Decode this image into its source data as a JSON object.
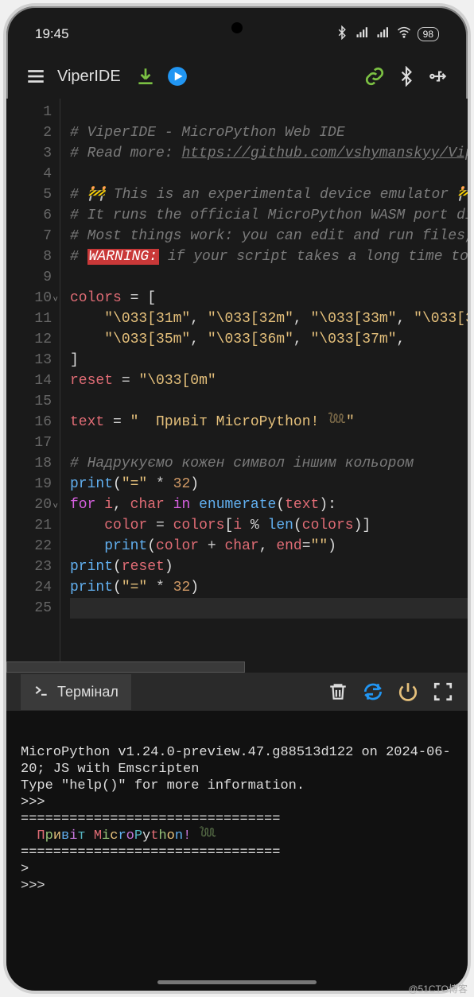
{
  "status": {
    "time": "19:45",
    "battery": "98"
  },
  "app": {
    "title": "ViperIDE"
  },
  "editor": {
    "lines": [
      {
        "n": 1,
        "html": ""
      },
      {
        "n": 2,
        "html": "<span class='c'># ViperIDE - MicroPython Web IDE</span>"
      },
      {
        "n": 3,
        "html": "<span class='c'># Read more: <a>https://github.com/vshymanskyy/Vip</a></span>"
      },
      {
        "n": 4,
        "html": ""
      },
      {
        "n": 5,
        "html": "<span class='c'># 🚧 This is an experimental device emulator 🚧</span>"
      },
      {
        "n": 6,
        "html": "<span class='c'># It runs the official MicroPython WASM port di</span>"
      },
      {
        "n": 7,
        "html": "<span class='c'># Most things work: you can edit and run files,</span>"
      },
      {
        "n": 8,
        "html": "<span class='c'># </span><span class='warn'>WARNING:</span><span class='c'> if your script takes a long time to </span>"
      },
      {
        "n": 9,
        "html": ""
      },
      {
        "n": 10,
        "fold": true,
        "html": "<span class='var'>colors</span> <span class='op'>=</span> ["
      },
      {
        "n": 11,
        "html": "    <span class='str'>\"\\033[31m\"</span>, <span class='str'>\"\\033[32m\"</span>, <span class='str'>\"\\033[33m\"</span>, <span class='str'>\"\\033[3</span>"
      },
      {
        "n": 12,
        "html": "    <span class='str'>\"\\033[35m\"</span>, <span class='str'>\"\\033[36m\"</span>, <span class='str'>\"\\033[37m\"</span>,"
      },
      {
        "n": 13,
        "html": "]"
      },
      {
        "n": 14,
        "html": "<span class='var'>reset</span> <span class='op'>=</span> <span class='str'>\"\\033[0m\"</span>"
      },
      {
        "n": 15,
        "html": ""
      },
      {
        "n": 16,
        "html": "<span class='var'>text</span> <span class='op'>=</span> <span class='str'>\"  Привіт MicroPython! 𓆙\"</span>"
      },
      {
        "n": 17,
        "html": ""
      },
      {
        "n": 18,
        "html": "<span class='c'># Надрукуємо кожен символ іншим кольором</span>"
      },
      {
        "n": 19,
        "html": "<span class='fn'>print</span>(<span class='str'>\"=\"</span> <span class='op'>*</span> <span class='num'>32</span>)"
      },
      {
        "n": 20,
        "fold": true,
        "html": "<span class='kw'>for</span> <span class='var'>i</span>, <span class='var'>char</span> <span class='kw'>in</span> <span class='fn'>enumerate</span>(<span class='var'>text</span>):"
      },
      {
        "n": 21,
        "html": "    <span class='var'>color</span> <span class='op'>=</span> <span class='var'>colors</span>[<span class='var'>i</span> <span class='op'>%</span> <span class='fn'>len</span>(<span class='var'>colors</span>)]"
      },
      {
        "n": 22,
        "html": "    <span class='fn'>print</span>(<span class='var'>color</span> <span class='op'>+</span> <span class='var'>char</span>, <span class='var'>end</span><span class='op'>=</span><span class='str'>\"\"</span>)"
      },
      {
        "n": 23,
        "html": "<span class='fn'>print</span>(<span class='var'>reset</span>)"
      },
      {
        "n": 24,
        "html": "<span class='fn'>print</span>(<span class='str'>\"=\"</span> <span class='op'>*</span> <span class='num'>32</span>)"
      },
      {
        "n": 25,
        "highlight": true,
        "html": ""
      }
    ]
  },
  "terminal": {
    "label": "Термінал",
    "banner_line1": "MicroPython v1.24.0-preview.47.g88513d122 on 2024-06-20; JS with Emscripten",
    "banner_line2": "Type \"help()\" for more information.",
    "prompt1": ">>>",
    "sep": "================================",
    "colored_html": "  <span class='tr'>П</span><span class='tg'>р</span><span class='ty'>и</span><span class='tb'>в</span><span class='tm'>і</span><span class='tc'>т</span><span class='tw'> </span><span class='tr'>M</span><span class='tg'>i</span><span class='ty'>c</span><span class='tb'>r</span><span class='tm'>o</span><span class='tc'>P</span><span class='tw'>y</span><span class='tr'>t</span><span class='tg'>h</span><span class='ty'>o</span><span class='tb'>n</span><span class='tm'>!</span> <span class='tg'>𓆙</span>",
    "partial_prompt": ">",
    "prompt2": ">>>"
  },
  "watermark": "@51CTO博客"
}
